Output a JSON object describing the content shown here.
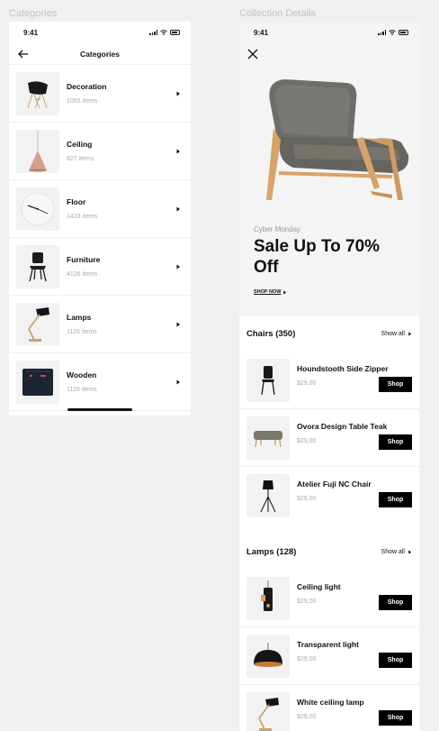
{
  "canvas": {
    "left_label": "Categories",
    "right_label": "Collection Details"
  },
  "status": {
    "time": "9:41"
  },
  "categories_screen": {
    "title": "Categories",
    "items": [
      {
        "name": "Decoration",
        "count": "1065 items",
        "icon": "eames-chair"
      },
      {
        "name": "Ceiling",
        "count": "827 items",
        "icon": "pendant-lamp"
      },
      {
        "name": "Floor",
        "count": "1423 items",
        "icon": "wall-clock"
      },
      {
        "name": "Furniture",
        "count": "4126 items",
        "icon": "black-chair"
      },
      {
        "name": "Lamps",
        "count": "1126 items",
        "icon": "desk-lamp"
      },
      {
        "name": "Wooden",
        "count": "1126 items",
        "icon": "navy-bag"
      }
    ]
  },
  "collection_screen": {
    "promo": {
      "eyebrow": "Cyber Monday",
      "headline": "Sale Up To 70% Off",
      "cta": "SHOP NOW"
    },
    "sections": [
      {
        "title": "Chairs (350)",
        "show_all": "Show all",
        "products": [
          {
            "name": "Houndstooth Side Zipper",
            "price": "$29,00",
            "button": "Shop"
          },
          {
            "name": "Ovora Design Table Teak",
            "price": "$29,00",
            "button": "Shop"
          },
          {
            "name": "Atelier Fuji NC Chair",
            "price": "$29,00",
            "button": "Shop"
          }
        ]
      },
      {
        "title": "Lamps (128)",
        "show_all": "Show all",
        "products": [
          {
            "name": "Ceiling light",
            "price": "$29,00",
            "button": "Shop"
          },
          {
            "name": "Transparent light",
            "price": "$29,00",
            "button": "Shop"
          },
          {
            "name": "White ceiling lamp",
            "price": "$29,00",
            "button": "Shop"
          }
        ]
      }
    ]
  },
  "colors": {
    "background": "#f0f0f0",
    "button": "#000000",
    "muted": "#aaaaaa"
  }
}
